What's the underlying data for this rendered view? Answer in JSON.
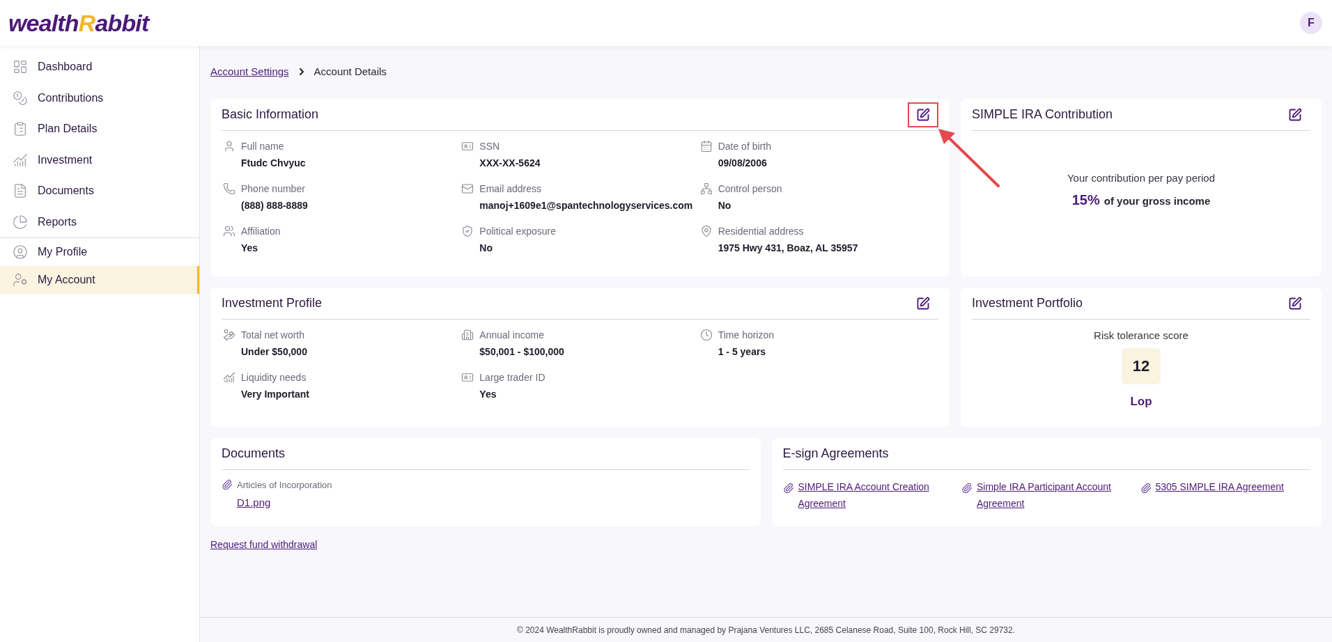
{
  "header": {
    "logo": {
      "part_1": "wealth",
      "initial": "R",
      "part_2": "abbit"
    },
    "avatar": "F"
  },
  "sidebar": {
    "groups": [
      [
        {
          "label": "Dashboard",
          "selected": false
        },
        {
          "label": "Contributions",
          "selected": false
        },
        {
          "label": "Plan Details",
          "selected": false
        },
        {
          "label": "Investment",
          "selected": false
        },
        {
          "label": "Documents",
          "selected": false
        },
        {
          "label": "Reports",
          "selected": false
        }
      ],
      [
        {
          "label": "My Profile",
          "selected": false
        },
        {
          "label": "My Account",
          "selected": true
        }
      ]
    ]
  },
  "breadcrumb": {
    "link": "Account Settings",
    "current": "Account Details"
  },
  "basic_information": {
    "title": "Basic Information",
    "edit_highlighted": true,
    "fields": [
      {
        "label": "Full name",
        "value": "Ftudc Chvyuc"
      },
      {
        "label": "SSN",
        "value": "XXX-XX-5624"
      },
      {
        "label": "Date of birth",
        "value": "09/08/2006"
      },
      {
        "label": "Phone number",
        "value": "(888) 888-8889"
      },
      {
        "label": "Email address",
        "value": "manoj+1609e1@spantechnologyservices.com"
      },
      {
        "label": "Control person",
        "value": "No"
      },
      {
        "label": "Affiliation",
        "value": "Yes"
      },
      {
        "label": "Political exposure",
        "value": "No"
      },
      {
        "label": "Residential address",
        "value": "1975 Hwy 431, Boaz, AL 35957"
      }
    ]
  },
  "simple_ira_contribution": {
    "title": "SIMPLE IRA Contribution",
    "edit_highlighted": false,
    "caption": "Your contribution per pay period",
    "percent": "15%",
    "suffix": "of your gross income"
  },
  "investment_profile": {
    "title": "Investment Profile",
    "edit_highlighted": false,
    "fields": [
      {
        "label": "Total net worth",
        "value": "Under $50,000"
      },
      {
        "label": "Annual income",
        "value": "$50,001 - $100,000"
      },
      {
        "label": "Time horizon",
        "value": "1 - 5 years"
      },
      {
        "label": "Liquidity needs",
        "value": "Very Important"
      },
      {
        "label": "Large trader ID",
        "value": "Yes"
      }
    ]
  },
  "investment_portfolio": {
    "title": "Investment Portfolio",
    "edit_highlighted": false,
    "label": "Risk tolerance score",
    "score": "12",
    "category": "Lop"
  },
  "documents": {
    "title": "Documents",
    "items": [
      {
        "label": "Articles of Incorporation",
        "file": "D1.png"
      }
    ]
  },
  "esign_agreements": {
    "title": "E-sign Agreements",
    "links": [
      "SIMPLE IRA Account Creation Agreement",
      "Simple IRA Participant Account Agreement",
      "5305 SIMPLE IRA Agreement"
    ]
  },
  "request_link": "Request fund withdrawal",
  "footer": "© 2024 WealthRabbit is proudly owned and managed by Prajana Ventures LLC, 2685 Celanese Road, Suite 100, Rock Hill, SC 29732."
}
